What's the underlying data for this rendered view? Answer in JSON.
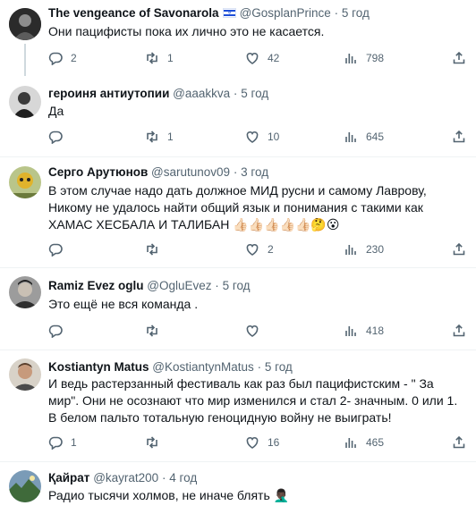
{
  "tweets": [
    {
      "name": "The vengeance of Savonarola",
      "handle": "@GosplanPrince",
      "dot": "·",
      "time": "5 год",
      "text": "Они пацифисты пока их лично это не касается.",
      "reply_count": "2",
      "retweet_count": "1",
      "like_count": "42",
      "view_count": "798",
      "avatar_color": "#2b2b2b"
    },
    {
      "name": "героиня антиутопии",
      "handle": "@aaakkva",
      "dot": "·",
      "time": "5 год",
      "text": "Да",
      "reply_count": "",
      "retweet_count": "1",
      "like_count": "10",
      "view_count": "645",
      "avatar_color": "#3a3a3a"
    },
    {
      "name": "Серго Арутюнов",
      "handle": "@sarutunov09",
      "dot": "·",
      "time": "3 год",
      "text": "В этом случае надо дать должное МИД русни и самому Лаврову, Никому не удалось найти общий язык и понимания с такими как ХАМАС ХЕСБАЛА И ТАЛИБАН 👍🏻👍🏻👍🏻👍🏻👍🏻🤔😮",
      "reply_count": "",
      "retweet_count": "",
      "like_count": "2",
      "view_count": "230",
      "avatar_color": "#6b7a3c"
    },
    {
      "name": "Ramiz Evez oglu",
      "handle": "@OgluEvez",
      "dot": "·",
      "time": "5 год",
      "text": "Это ещё не вся команда .",
      "reply_count": "",
      "retweet_count": "",
      "like_count": "",
      "view_count": "418",
      "avatar_color": "#4a4a4a"
    },
    {
      "name": "Kostiantyn Matus",
      "handle": "@KostiantynMatus",
      "dot": "·",
      "time": "5 год",
      "text": "И ведь растерзанный фестиваль как раз был пацифистским - \" За мир\". Они не осознают что мир изменился и стал 2- значным. 0 или 1. В белом пальто тотальную геноцидную войну не выиграть!",
      "reply_count": "1",
      "retweet_count": "",
      "like_count": "16",
      "view_count": "465",
      "avatar_color": "#8a6a52"
    },
    {
      "name": "Қайрат",
      "handle": "@kayrat200",
      "dot": "·",
      "time": "4 год",
      "text": "Радио тысячи холмов, не иначе блять 🤦🏿‍♂️",
      "avatar_color": "#3f6a3a"
    }
  ]
}
